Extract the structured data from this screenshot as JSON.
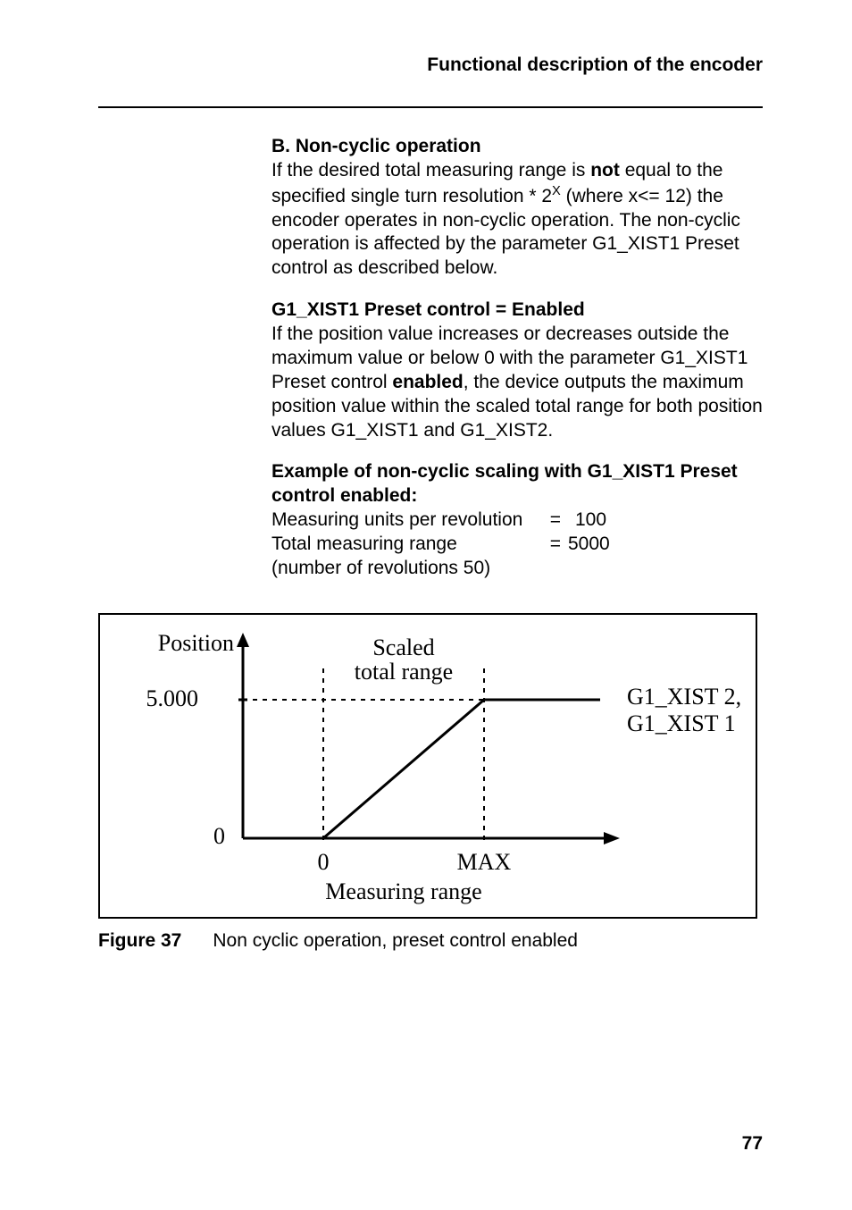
{
  "header": {
    "running_head": "Functional description of the encoder"
  },
  "section_b": {
    "title": "B. Non-cyclic operation",
    "p1_before_not": "If the desired total measuring range is ",
    "p1_not": "not",
    "p1_after_not": " equal to the specified single turn resolution * 2",
    "p1_exp": "X",
    "p1_after_exp": " (where x<= 12) the encoder operates in non-cyclic operation. The non-cyclic operation is affected by the parameter G1_XIST1 Preset control as described below."
  },
  "section_g1": {
    "title": "G1_XIST1 Preset control = Enabled",
    "p_before_en": "If the position value increases or decreases outside the maximum value or below 0 with the parameter G1_XIST1 Preset control ",
    "p_en": "en­abled",
    "p_after_en": ", the device outputs the maximum position value within the scaled total range for both position values G1_XIST1 and G1_XIST2."
  },
  "example": {
    "title": "Example of non-cyclic scaling with G1_XIST1 Preset control enabled:",
    "row1_label": "Measuring units per revolution",
    "row1_val": "100",
    "row2_label": "Total measuring range",
    "row2_val": "5000",
    "row3_label": "(number of revolutions 50)"
  },
  "figure": {
    "label": "Figure 37",
    "caption": "Non cyclic operation, preset control enabled",
    "y_axis_label": "Position",
    "y_tick_top": "5.000",
    "y_tick_bot": "0",
    "top_label_1": "Scaled",
    "top_label_2": "total range",
    "x_tick_0": "0",
    "x_tick_max": "MAX",
    "x_axis_label": "Measuring range",
    "series_1": "G1_XIST 2,",
    "series_2": "G1_XIST 1"
  },
  "page_number": "77",
  "chart_data": {
    "type": "line",
    "title": "Non cyclic operation, preset control enabled",
    "xlabel": "Measuring range",
    "ylabel": "Position",
    "x_ticks": [
      "0",
      "MAX"
    ],
    "y_ticks": [
      0,
      5000
    ],
    "series": [
      {
        "name": "G1_XIST 2, G1_XIST 1",
        "x": [
          "<0",
          "0",
          "MAX",
          ">MAX"
        ],
        "y": [
          0,
          0,
          5000,
          5000
        ]
      }
    ],
    "annotations": [
      "Scaled total range"
    ]
  }
}
